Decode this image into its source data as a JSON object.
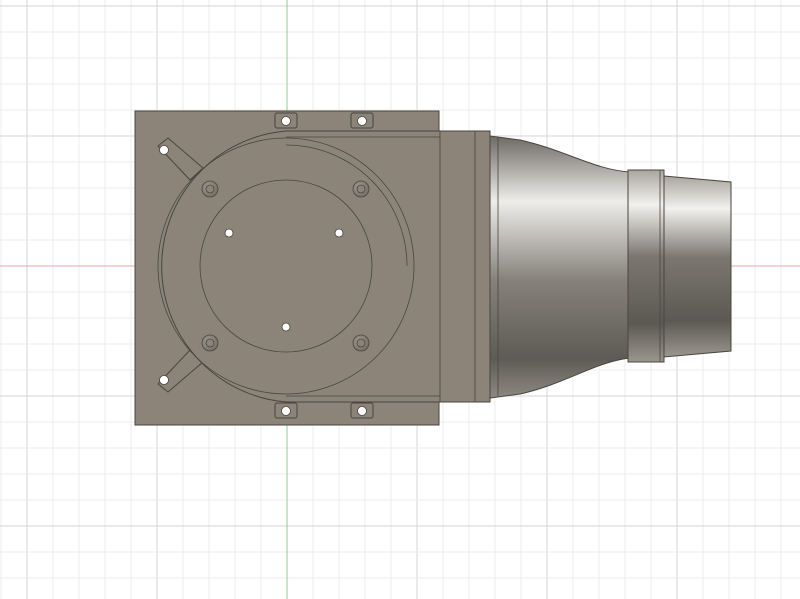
{
  "viewport": {
    "view": "top",
    "background_color": "#ffffff",
    "grid": {
      "minor_color": "#ececec",
      "major_color": "#d5d5d5",
      "axis_vertical_color": "#8fd28f",
      "axis_horizontal_color": "#e3a8a8"
    }
  },
  "model": {
    "body_color": "#8c8478",
    "body_edge_color": "#4a453f",
    "hole_color": "#ffffff",
    "nozzle_color": "#7a766f"
  }
}
